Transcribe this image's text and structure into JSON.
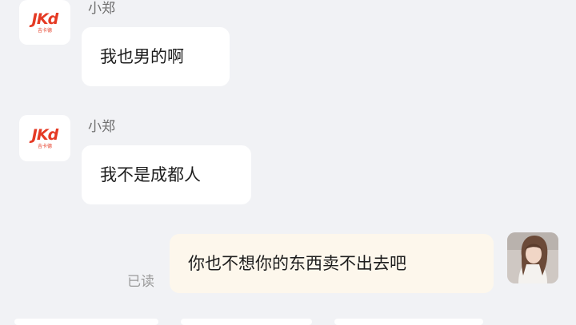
{
  "messages": [
    {
      "sender": "小郑",
      "text": "我也男的啊",
      "avatar": {
        "icon": "jkd-logo-icon",
        "mark": "JKd",
        "subtext": "吉卡德"
      }
    },
    {
      "sender": "小郑",
      "text": "我不是成都人",
      "avatar": {
        "icon": "jkd-logo-icon",
        "mark": "JKd",
        "subtext": "吉卡德"
      }
    }
  ],
  "outgoing": {
    "text": "你也不想你的东西卖不出去吧",
    "read_status": "已读",
    "avatar": {
      "icon": "user-photo-icon"
    }
  },
  "colors": {
    "background": "#f1f2f5",
    "incoming_bubble": "#ffffff",
    "outgoing_bubble": "#fdf7ec",
    "logo": "#e53a24",
    "read_status": "#9a9a9a"
  }
}
